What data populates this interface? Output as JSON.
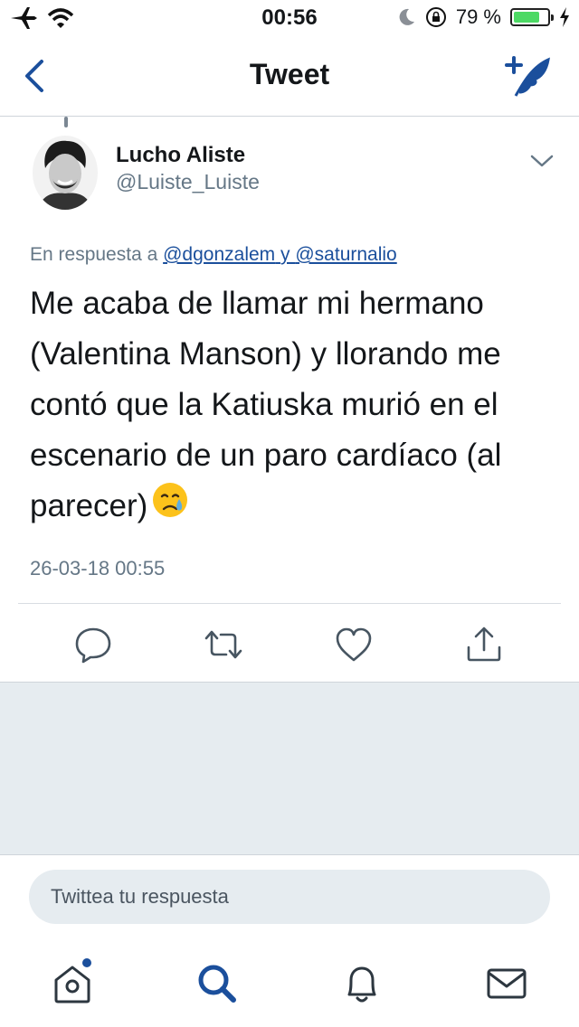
{
  "status_bar": {
    "time": "00:56",
    "battery_text": "79 %",
    "battery_level": 0.79,
    "battery_color": "#4cd964"
  },
  "nav": {
    "title": "Tweet",
    "back_icon": "chevron-left-icon",
    "compose_icon": "compose-tweet-icon"
  },
  "tweet": {
    "author_name": "Lucho Aliste",
    "author_handle": "@Luiste_Luiste",
    "reply_prefix": "En respuesta a",
    "reply_users": [
      "@dgonzalem",
      "@saturnalio"
    ],
    "reply_joiner": "y",
    "text": "Me acaba de llamar mi hermano (Valentina Manson) y llorando me contó que la Katiuska murió en el escenario de un paro cardíaco (al parecer)",
    "emoji": "crying-face-icon",
    "timestamp": "26-03-18 00:55"
  },
  "actions": [
    "reply-icon",
    "retweet-icon",
    "like-icon",
    "share-icon"
  ],
  "reply_input": {
    "placeholder": "Twittea tu respuesta",
    "value": ""
  },
  "tabbar": {
    "items": [
      "home-icon",
      "search-icon",
      "notifications-icon",
      "messages-icon"
    ],
    "active": "search-icon",
    "accent": "#1b4f9c"
  },
  "colors": {
    "accent": "#1b4f9c",
    "secondary_text": "#657786",
    "divider": "#d8dde2",
    "gray_background": "#e6ecf0"
  }
}
